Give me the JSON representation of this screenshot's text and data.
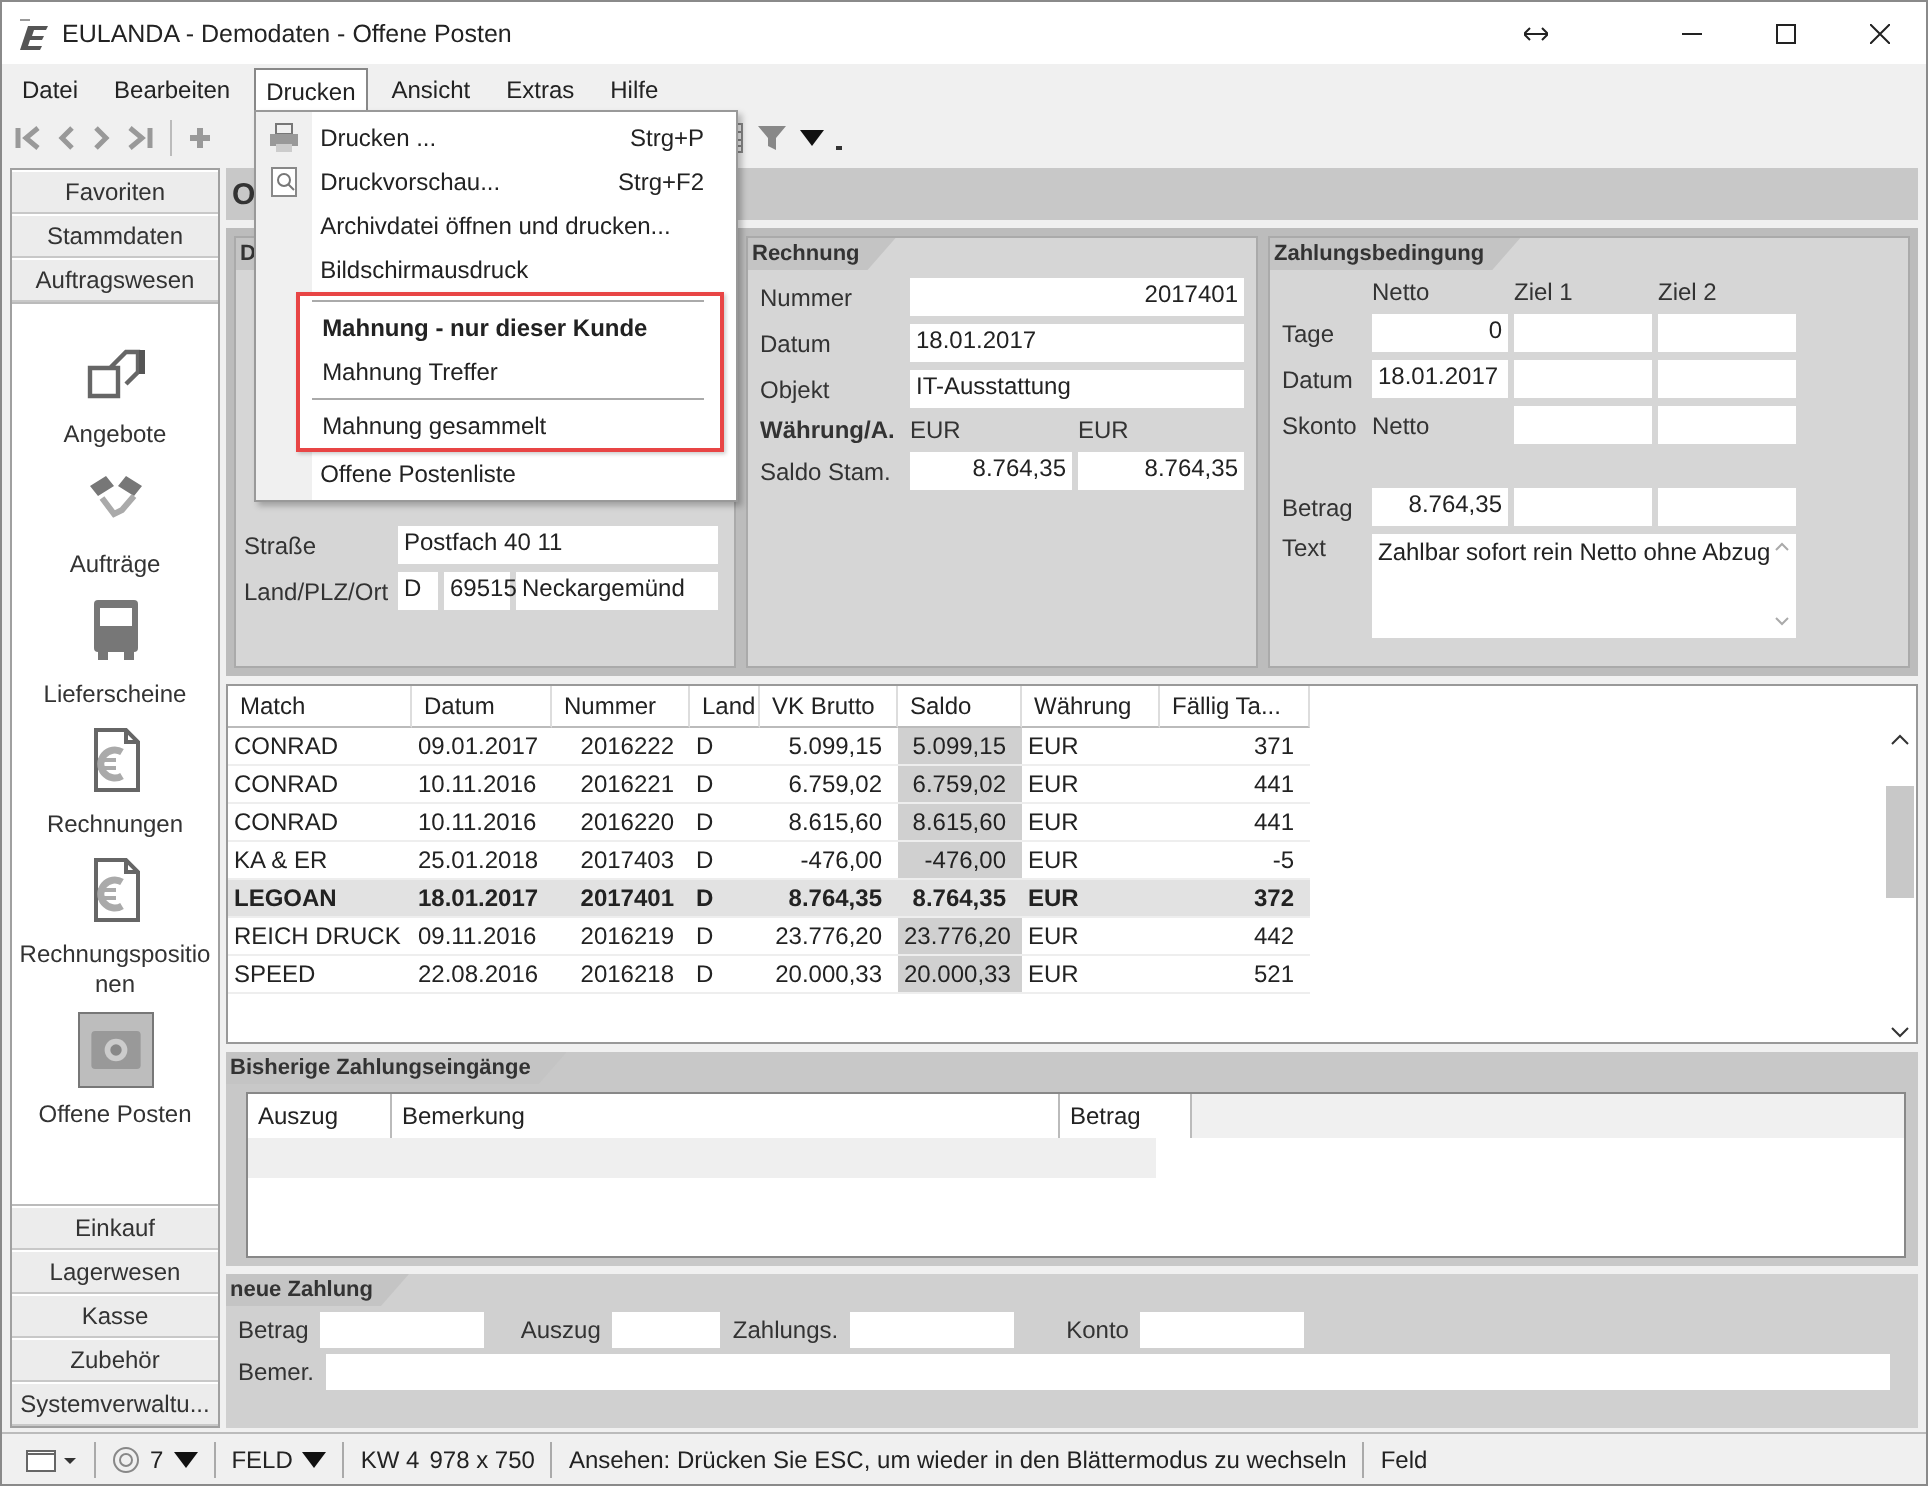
{
  "window": {
    "title": "EULANDA - Demodaten - Offene Posten"
  },
  "menu_bar": [
    {
      "label": "Datei",
      "selected": false
    },
    {
      "label": "Bearbeiten",
      "selected": false
    },
    {
      "label": "Drucken",
      "selected": true
    },
    {
      "label": "Ansicht",
      "selected": false
    },
    {
      "label": "Extras",
      "selected": false
    },
    {
      "label": "Hilfe",
      "selected": false
    }
  ],
  "dropdown": [
    {
      "kind": "item",
      "label": "Drucken ...",
      "shortcut": "Strg+P",
      "default": false,
      "marked": false
    },
    {
      "kind": "item",
      "label": "Druckvorschau...",
      "shortcut": "Strg+F2",
      "default": false,
      "marked": false
    },
    {
      "kind": "item",
      "label": "Archivdatei öffnen und drucken...",
      "default": false,
      "marked": false
    },
    {
      "kind": "item",
      "label": "Bildschirmausdruck",
      "default": false,
      "marked": false
    },
    {
      "kind": "separator",
      "marked": true
    },
    {
      "kind": "item",
      "label": "Mahnung - nur dieser Kunde",
      "default": true,
      "marked": true
    },
    {
      "kind": "item",
      "label": "Mahnung Treffer",
      "default": false,
      "marked": true
    },
    {
      "kind": "separator",
      "marked": true
    },
    {
      "kind": "item",
      "label": "Mahnung gesammelt",
      "default": false,
      "marked": true
    },
    {
      "kind": "item",
      "label": "Offene Postenliste",
      "default": false,
      "marked": false
    }
  ],
  "sidebar": {
    "top_groups": [
      "Favoriten",
      "Stammdaten",
      "Auftragswesen"
    ],
    "items": [
      {
        "label": "Angebote",
        "selected": false
      },
      {
        "label": "Aufträge",
        "selected": false
      },
      {
        "label": "Lieferscheine",
        "selected": false
      },
      {
        "label": "Rechnungen",
        "selected": false
      },
      {
        "label": "Rechnungspositionen",
        "selected": false
      },
      {
        "label": "Offene Posten",
        "selected": true
      }
    ],
    "bottom_groups": [
      "Einkauf",
      "Lagerwesen",
      "Kasse",
      "Zubehör",
      "Systemverwaltu..."
    ]
  },
  "header": {
    "title": "O"
  },
  "address": {
    "title": "D",
    "rows": [
      {
        "label": "Straße",
        "fields": [
          "Postfach 40 11"
        ]
      },
      {
        "label": "Land/PLZ/Ort",
        "fields": [
          "D",
          "69515",
          "Neckargemünd"
        ]
      }
    ]
  },
  "invoice": {
    "title": "Rechnung",
    "rows": [
      {
        "label": "Nummer",
        "kind": "wide",
        "cells": [
          "2017401"
        ]
      },
      {
        "label": "Datum",
        "kind": "wide",
        "cells": [
          "18.01.2017"
        ]
      },
      {
        "label": "Objekt",
        "kind": "wide",
        "cells": [
          "IT-Ausstattung"
        ]
      },
      {
        "label": "Währung/A.",
        "kind": "text",
        "cells": [
          "EUR",
          "EUR"
        ]
      },
      {
        "label": "Saldo Stam.",
        "kind": "pair",
        "cells": [
          "8.764,35",
          "8.764,35"
        ]
      }
    ]
  },
  "terms": {
    "title": "Zahlungsbedingung",
    "columns": [
      "Netto",
      "Ziel 1",
      "Ziel 2"
    ],
    "rows": [
      {
        "label": "Tage",
        "cells": [
          {
            "kind": "number",
            "value": "0"
          },
          {
            "kind": "field"
          },
          {
            "kind": "field"
          }
        ]
      },
      {
        "label": "Datum",
        "cells": [
          {
            "kind": "field",
            "value": "18.01.2017"
          },
          {
            "kind": "field"
          },
          {
            "kind": "field"
          }
        ]
      },
      {
        "label": "Skonto",
        "cells": [
          {
            "kind": "text",
            "value": "Netto"
          },
          {
            "kind": "field"
          },
          {
            "kind": "field"
          }
        ]
      },
      {
        "label": "Betrag",
        "cells": [
          {
            "kind": "number",
            "value": "8.764,35"
          },
          {
            "kind": "field"
          },
          {
            "kind": "field"
          }
        ]
      }
    ],
    "text_label": "Text",
    "text": "Zahlbar sofort rein Netto ohne Abzug"
  },
  "table": {
    "columns": [
      {
        "label": "Match",
        "shaded": false
      },
      {
        "label": "Datum",
        "shaded": false
      },
      {
        "label": "Nummer",
        "shaded": false
      },
      {
        "label": "Land",
        "shaded": false
      },
      {
        "label": "VK Brutto",
        "shaded": false
      },
      {
        "label": "Saldo",
        "shaded": true
      },
      {
        "label": "Währung",
        "shaded": false
      },
      {
        "label": "Fällig Ta...",
        "shaded": false
      }
    ],
    "rows": [
      {
        "selected": false,
        "cells": [
          "CONRAD",
          "09.01.2017",
          "2016222",
          "D",
          "5.099,15",
          "5.099,15",
          "EUR",
          "371"
        ]
      },
      {
        "selected": false,
        "cells": [
          "CONRAD",
          "10.11.2016",
          "2016221",
          "D",
          "6.759,02",
          "6.759,02",
          "EUR",
          "441"
        ]
      },
      {
        "selected": false,
        "cells": [
          "CONRAD",
          "10.11.2016",
          "2016220",
          "D",
          "8.615,60",
          "8.615,60",
          "EUR",
          "441"
        ]
      },
      {
        "selected": false,
        "cells": [
          "KA & ER",
          "25.01.2018",
          "2017403",
          "D",
          "-476,00",
          "-476,00",
          "EUR",
          "-5"
        ]
      },
      {
        "selected": true,
        "cells": [
          "LEGOAN",
          "18.01.2017",
          "2017401",
          "D",
          "8.764,35",
          "8.764,35",
          "EUR",
          "372"
        ]
      },
      {
        "selected": false,
        "cells": [
          "REICH DRUCK",
          "09.11.2016",
          "2016219",
          "D",
          "23.776,20",
          "23.776,20",
          "EUR",
          "442"
        ]
      },
      {
        "selected": false,
        "cells": [
          "SPEED",
          "22.08.2016",
          "2016218",
          "D",
          "20.000,33",
          "20.000,33",
          "EUR",
          "521"
        ]
      }
    ]
  },
  "payments": {
    "title": "Bisherige Zahlungseingänge",
    "columns": [
      "Auszug",
      "Bemerkung",
      "Betrag"
    ]
  },
  "new_payment": {
    "title": "neue Zahlung",
    "fields": [
      "Betrag",
      "Auszug",
      "Zahlungs.",
      "Konto"
    ],
    "remark_label": "Bemer."
  },
  "status_bar": {
    "count": "7",
    "mode": "FELD",
    "week": "KW 4",
    "size": "978 x 750",
    "message": "Ansehen: Drücken Sie ESC, um wieder in den Blättermodus zu wechseln",
    "field": "Feld"
  }
}
